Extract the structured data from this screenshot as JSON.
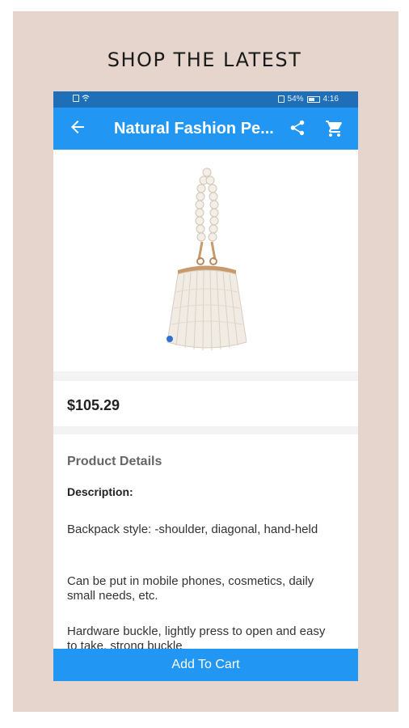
{
  "promo": {
    "headline": "SHOP THE LATEST"
  },
  "status_bar": {
    "battery": "54%",
    "time": "4:16"
  },
  "app_bar": {
    "title": "Natural Fashion Pe...",
    "icons": [
      "back-arrow-icon",
      "share-icon",
      "cart-icon"
    ]
  },
  "product": {
    "image": "pearl-handbag-image",
    "price": "$105.29",
    "section_title": "Product Details",
    "description_label": "Description:",
    "description": [
      "Backpack style:  -shoulder, diagonal, hand-held",
      "Can be put in mobile phones, cosmetics, daily small needs, etc.",
      "Hardware buckle, lightly press to open and easy to take, strong buckle"
    ]
  },
  "actions": {
    "add_to_cart": "Add To Cart"
  },
  "colors": {
    "primary": "#2196f3",
    "status_bar": "#1f6fb8",
    "frame": "#e6d5cc"
  }
}
